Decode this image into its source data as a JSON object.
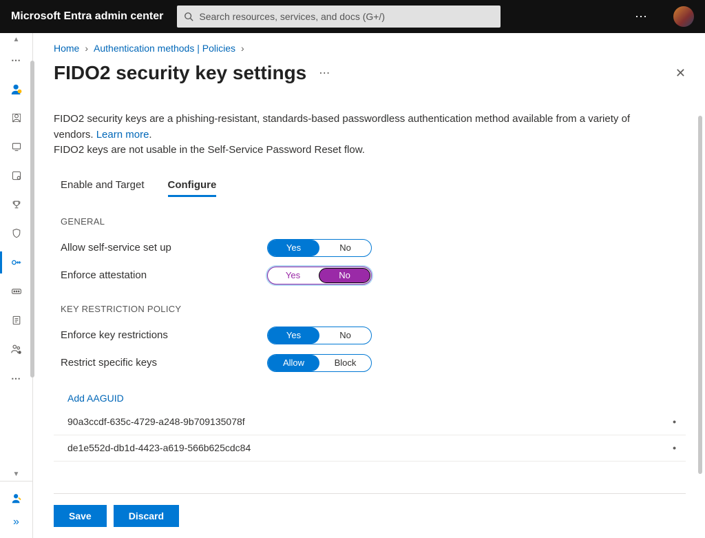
{
  "header": {
    "app_title": "Microsoft Entra admin center",
    "search_placeholder": "Search resources, services, and docs (G+/)"
  },
  "breadcrumb": {
    "home": "Home",
    "auth_methods": "Authentication methods | Policies"
  },
  "page": {
    "title": "FIDO2 security key settings",
    "desc_line1_prefix": "FIDO2 security keys are a phishing-resistant, standards-based passwordless authentication method available from a variety of vendors. ",
    "learn_more": "Learn more",
    "desc_line2": "FIDO2 keys are not usable in the Self-Service Password Reset flow."
  },
  "tabs": {
    "enable": "Enable and Target",
    "configure": "Configure"
  },
  "sections": {
    "general": "GENERAL",
    "key_restriction": "KEY RESTRICTION POLICY"
  },
  "settings": {
    "self_service": {
      "label": "Allow self-service set up",
      "yes": "Yes",
      "no": "No",
      "value": "Yes"
    },
    "attestation": {
      "label": "Enforce attestation",
      "yes": "Yes",
      "no": "No",
      "value": "No"
    },
    "key_restrictions": {
      "label": "Enforce key restrictions",
      "yes": "Yes",
      "no": "No",
      "value": "Yes"
    },
    "restrict_keys": {
      "label": "Restrict specific keys",
      "allow": "Allow",
      "block": "Block",
      "value": "Allow"
    }
  },
  "aaguid": {
    "add_label": "Add AAGUID",
    "items": [
      "90a3ccdf-635c-4729-a248-9b709135078f",
      "de1e552d-db1d-4423-a619-566b625cdc84"
    ]
  },
  "footer": {
    "save": "Save",
    "discard": "Discard"
  }
}
